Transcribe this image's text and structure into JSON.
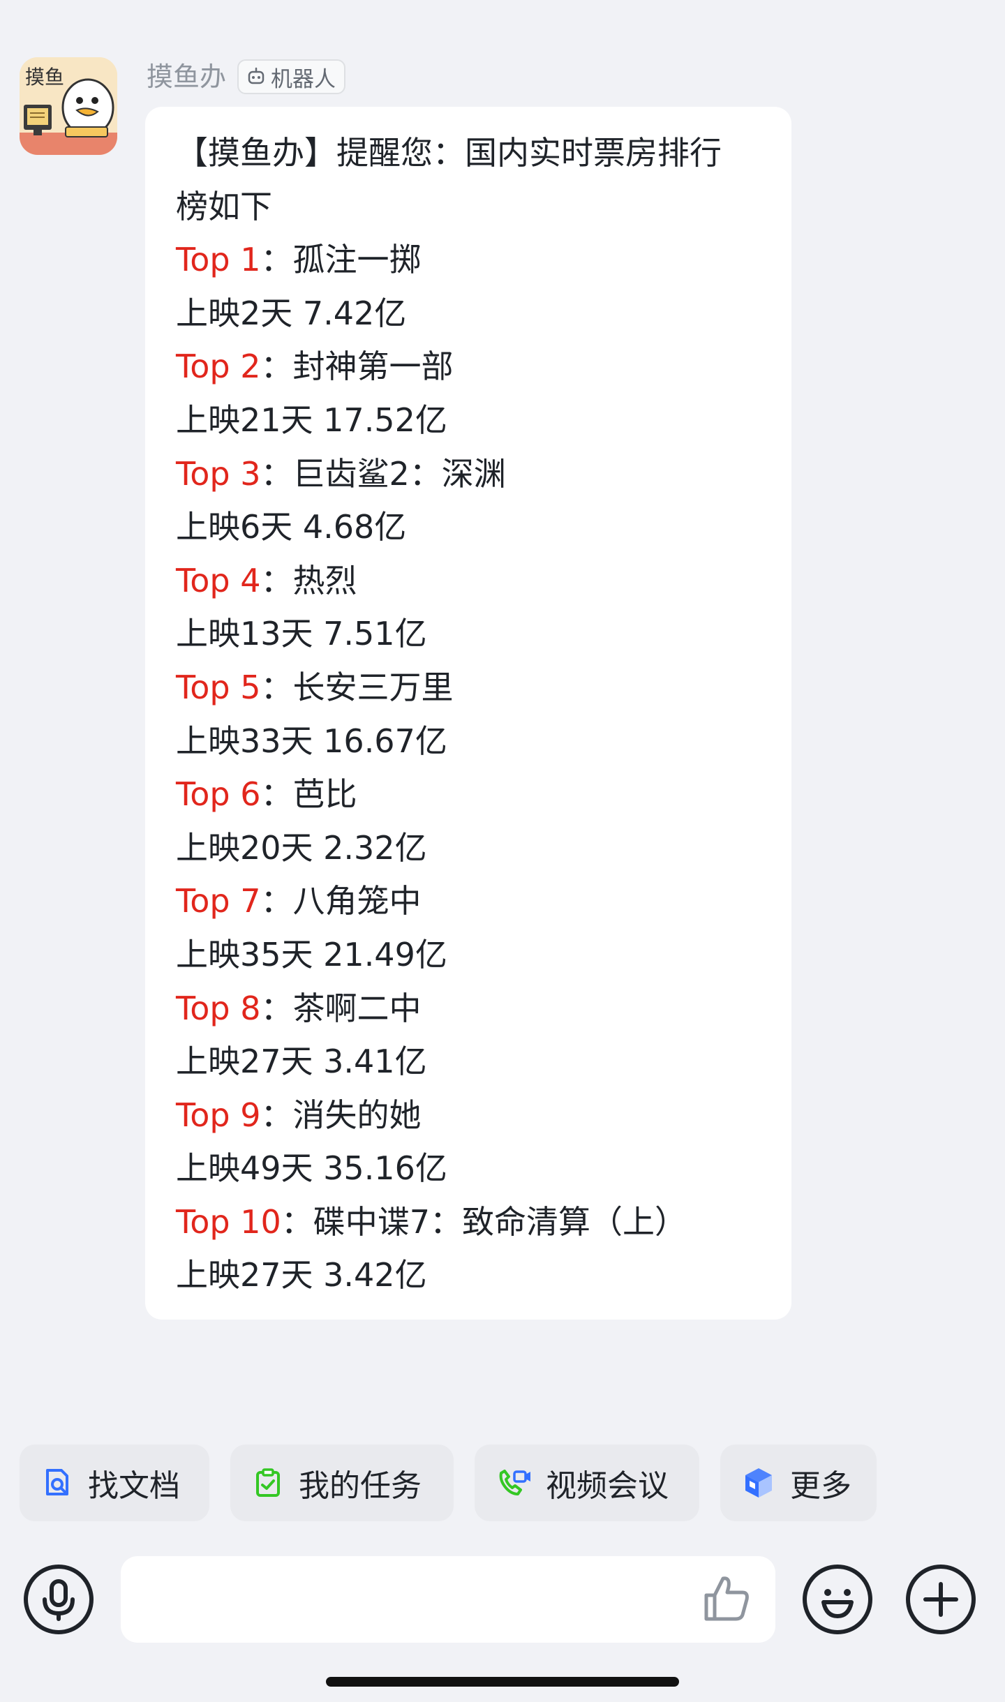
{
  "sender": {
    "name": "摸鱼办",
    "tag": "机器人",
    "avatar_text": "摸鱼"
  },
  "message": {
    "intro": "【摸鱼办】提醒您：国内实时票房排行",
    "intro_cont": "榜如下",
    "items": [
      {
        "label": "Top 1",
        "sep": "：",
        "title": "孤注一掷",
        "detail": "上映2天 7.42亿"
      },
      {
        "label": "Top 2",
        "sep": "：",
        "title": "封神第一部",
        "detail": "上映21天 17.52亿"
      },
      {
        "label": "Top 3",
        "sep": "：",
        "title": "巨齿鲨2：深渊",
        "detail": "上映6天 4.68亿"
      },
      {
        "label": "Top 4",
        "sep": "：",
        "title": "热烈",
        "detail": "上映13天 7.51亿"
      },
      {
        "label": "Top 5",
        "sep": "：",
        "title": "长安三万里",
        "detail": "上映33天 16.67亿"
      },
      {
        "label": "Top 6",
        "sep": "：",
        "title": "芭比",
        "detail": "上映20天 2.32亿"
      },
      {
        "label": "Top 7",
        "sep": "：",
        "title": "八角笼中",
        "detail": "上映35天 21.49亿"
      },
      {
        "label": "Top 8",
        "sep": "：",
        "title": "茶啊二中",
        "detail": "上映27天 3.41亿"
      },
      {
        "label": "Top 9",
        "sep": "：",
        "title": "消失的她",
        "detail": "上映49天 35.16亿"
      },
      {
        "label": "Top 10",
        "sep": "：",
        "title": "碟中谍7：致命清算（上）",
        "detail": "上映27天 3.42亿"
      }
    ]
  },
  "shortcuts": [
    {
      "label": "找文档",
      "icon": "doc-search-icon"
    },
    {
      "label": "我的任务",
      "icon": "task-clipboard-icon"
    },
    {
      "label": "视频会议",
      "icon": "video-call-icon"
    },
    {
      "label": "更多",
      "icon": "more-cube-icon"
    }
  ],
  "input": {
    "placeholder": ""
  },
  "colors": {
    "top_label": "#e1261c",
    "background": "#f1f2f6",
    "bubble": "#ffffff",
    "shortcut_blue": "#3370ff",
    "shortcut_green": "#34c724"
  }
}
